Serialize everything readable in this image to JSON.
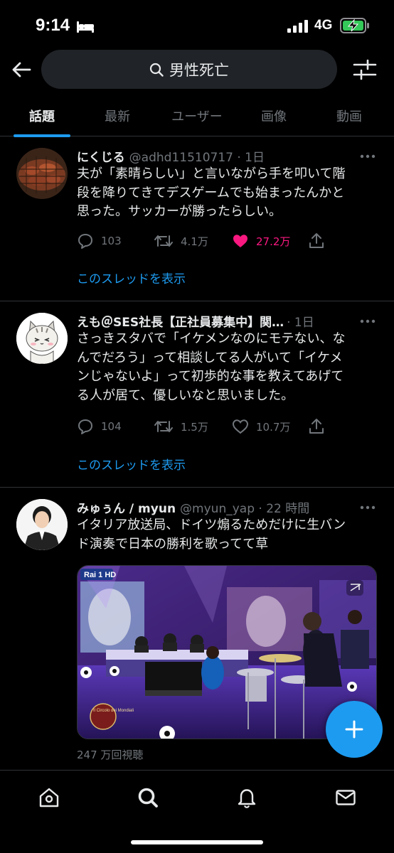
{
  "status_bar": {
    "time": "9:14",
    "network": "4G"
  },
  "search": {
    "query": "男性死亡"
  },
  "tabs": [
    {
      "label": "話題",
      "active": true
    },
    {
      "label": "最新"
    },
    {
      "label": "ユーザー"
    },
    {
      "label": "画像"
    },
    {
      "label": "動画"
    }
  ],
  "tweets": [
    {
      "name": "にくじる",
      "handle": "@adhd11510717 · 1日",
      "text": "夫が「素晴らしい」と言いながら手を叩いて階\n段を降りてきてデスゲームでも始まったんかと\n思った。サッカーが勝ったらしい。",
      "replies": "103",
      "retweets": "4.1万",
      "likes": "27.2万",
      "liked": true,
      "thread_link": "このスレッドを表示"
    },
    {
      "name": "えも＠SES社長【正社員募集中】関…",
      "handle": "· 1日",
      "text": "さっきスタバで「イケメンなのにモテない、な\nんでだろう」って相談してる人がいて「イケメ\nンじゃないよ」って初歩的な事を教えてあげて\nる人が居て、優しいなと思いました。",
      "replies": "104",
      "retweets": "1.5万",
      "likes": "10.7万",
      "liked": false,
      "thread_link": "このスレッドを表示"
    },
    {
      "name": "みゅぅん / myun",
      "handle": "@myun_yap · 22 時間",
      "text": "イタリア放送局、ドイツ煽るためだけに生バン\nド演奏で日本の勝利を歌ってて草",
      "media": {
        "channel_logo": "Rai 1 HD",
        "show_title": "Il Circolo dei Mondiali"
      },
      "views": "247 万回視聴"
    }
  ],
  "colors": {
    "accent": "#1d9bf0",
    "like": "#f91880",
    "background": "#000000",
    "secondary_text": "#71767b"
  },
  "icons": {
    "back": "arrow-left-icon",
    "search": "search-icon",
    "filter": "sliders-icon",
    "compose": "plus-icon",
    "nav": [
      "home-icon",
      "search-icon",
      "bell-icon",
      "mail-icon"
    ]
  }
}
